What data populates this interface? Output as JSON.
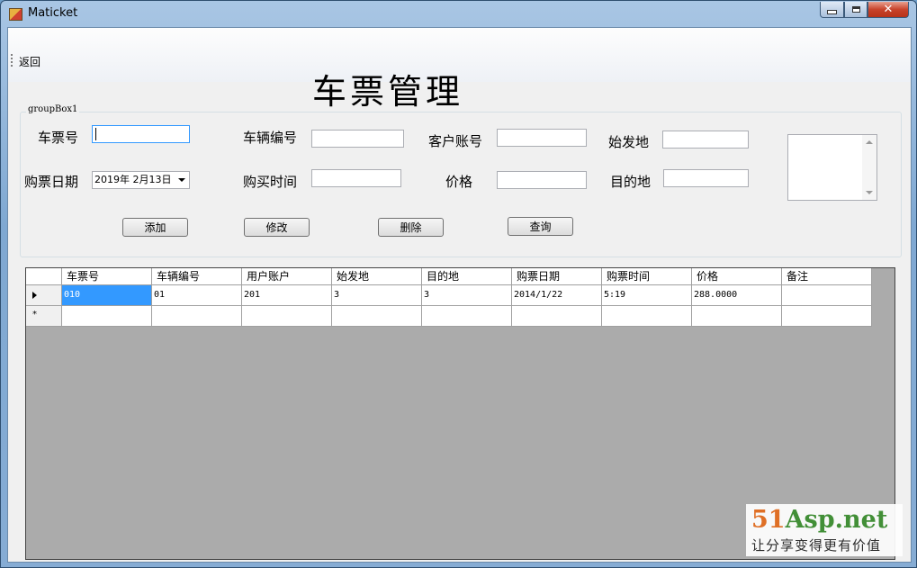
{
  "window": {
    "title": "Maticket",
    "icons": {
      "app": "app-icon",
      "minimize": "minimize-icon",
      "maximize": "maximize-icon",
      "close": "close-icon"
    }
  },
  "toolbar": {
    "back_label": "返回"
  },
  "page_title": "车票管理",
  "groupbox": {
    "label": "groupBox1"
  },
  "form": {
    "ticket_no_label": "车票号",
    "vehicle_no_label": "车辆编号",
    "customer_account_label": "客户账号",
    "origin_label": "始发地",
    "purchase_date_label": "购票日期",
    "purchase_date_value": "2019年 2月13日",
    "purchase_time_label": "购买时间",
    "price_label": "价格",
    "destination_label": "目的地"
  },
  "buttons": {
    "add": "添加",
    "edit": "修改",
    "delete": "删除",
    "query": "查询"
  },
  "grid": {
    "columns": [
      "车票号",
      "车辆编号",
      "用户账户",
      "始发地",
      "目的地",
      "购票日期",
      "购票时间",
      "价格",
      "备注"
    ],
    "rows": [
      [
        "010",
        "01",
        "201",
        "3",
        "3",
        "2014/1/22",
        "5:19",
        "288.0000",
        ""
      ]
    ],
    "new_row_marker": "*"
  },
  "watermark": {
    "logo_a": "51",
    "logo_b": "Asp.net",
    "slogan": "让分享变得更有价值"
  },
  "colors": {
    "selection": "#3399ff",
    "grid_background": "#ababab",
    "title_bar": "#7fa8d2"
  }
}
